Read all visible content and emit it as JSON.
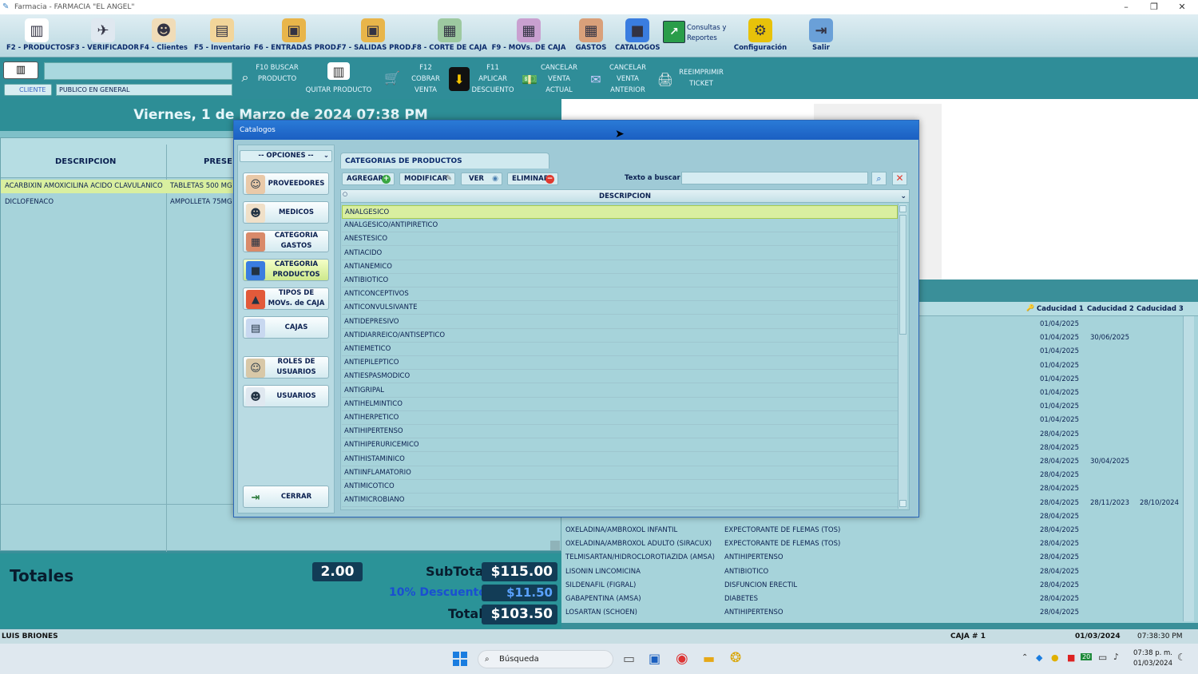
{
  "window": {
    "title": "Farmacia  -  FARMACIA \"EL ANGEL\""
  },
  "toolbar1": [
    {
      "label": "F2 - PRODUCTOS",
      "icon": "barcode-icon",
      "name": "productos"
    },
    {
      "label": "F3 - VERIFICADOR",
      "icon": "scanner-icon",
      "name": "verificador"
    },
    {
      "label": "F4 - Clientes",
      "icon": "clients-icon",
      "name": "clientes"
    },
    {
      "label": "F5 - Inventario",
      "icon": "inventory-icon",
      "name": "inventario"
    },
    {
      "label": "F6 - ENTRADAS PROD.",
      "icon": "box-in-icon",
      "name": "entradas"
    },
    {
      "label": "F7 - SALIDAS PROD.",
      "icon": "box-out-icon",
      "name": "salidas"
    },
    {
      "label": "F8 - CORTE DE CAJA",
      "icon": "register-icon",
      "name": "corte"
    },
    {
      "label": "F9 - MOVs. DE CAJA",
      "icon": "cash-moves-icon",
      "name": "movs"
    },
    {
      "label": "GASTOS",
      "icon": "expenses-icon",
      "name": "gastos"
    },
    {
      "label": "CATALOGOS",
      "icon": "cubes-icon",
      "name": "catalogos"
    },
    {
      "label": "Configuración",
      "icon": "gear-icon",
      "name": "configuracion"
    },
    {
      "label": "Salir",
      "icon": "exit-icon",
      "name": "salir"
    }
  ],
  "consultas_label": "Consultas y Reportes",
  "toolbar2": {
    "cliente_label": "CLIENTE",
    "cliente_value": "PUBLICO EN GENERAL",
    "buscar": "F10 BUSCAR PRODUCTO",
    "quitar": "QUITAR PRODUCTO",
    "cobrar": "F12 COBRAR VENTA",
    "descuento": "F11 APLICAR DESCUENTO",
    "cancelar_actual": "CANCELAR VENTA ACTUAL",
    "cancelar_anterior": "CANCELAR VENTA ANTERIOR",
    "reimprimir": "REEIMPRIMIR TICKET"
  },
  "date_text": "Viernes, 1 de Marzo de 2024  07:38 PM",
  "sale_grid": {
    "headers": [
      "DESCRIPCION",
      "PRESE"
    ],
    "rows": [
      {
        "desc": "ACARBIXIN AMOXICILINA  ACIDO CLAVULANICO",
        "pres": "TABLETAS 500 MG"
      },
      {
        "desc": "DICLOFENACO",
        "pres": "AMPOLLETA 75MG"
      }
    ]
  },
  "totals": {
    "label": "Totales",
    "qty": "2.00",
    "subtotal_label": "SubTotal",
    "subtotal": "$115.00",
    "discount_label": "10% Descuento",
    "discount": "$11.50",
    "total_label": "Total",
    "total": "$103.50"
  },
  "expiry_grid": {
    "headers": [
      "Caducidad 1",
      "Caducidad 2",
      "Caducidad 3"
    ],
    "top_rows": [
      [
        "01/04/2025",
        "",
        ""
      ],
      [
        "01/04/2025",
        "30/06/2025",
        ""
      ],
      [
        "01/04/2025",
        "",
        ""
      ],
      [
        "01/04/2025",
        "",
        ""
      ],
      [
        "01/04/2025",
        "",
        ""
      ],
      [
        "01/04/2025",
        "",
        ""
      ],
      [
        "01/04/2025",
        "",
        ""
      ],
      [
        "01/04/2025",
        "",
        ""
      ],
      [
        "28/04/2025",
        "",
        ""
      ],
      [
        "28/04/2025",
        "",
        ""
      ],
      [
        "28/04/2025",
        "30/04/2025",
        ""
      ],
      [
        "28/04/2025",
        "",
        ""
      ],
      [
        "28/04/2025",
        "",
        ""
      ],
      [
        "28/04/2025",
        "28/11/2023",
        "28/10/2024"
      ],
      [
        "28/04/2025",
        "",
        ""
      ]
    ],
    "bottom_rows": [
      {
        "prod": "OXELADINA/AMBROXOL INFANTIL",
        "cat": "EXPECTORANTE DE FLEMAS (TOS)",
        "c1": "28/04/2025"
      },
      {
        "prod": "OXELADINA/AMBROXOL ADULTO (SIRACUX)",
        "cat": "EXPECTORANTE DE FLEMAS (TOS)",
        "c1": "28/04/2025"
      },
      {
        "prod": "TELMISARTAN/HIDROCLOROTIAZIDA (AMSA)",
        "cat": "ANTIHIPERTENSO",
        "c1": "28/04/2025"
      },
      {
        "prod": "LISONIN LINCOMICINA",
        "cat": "ANTIBIOTICO",
        "c1": "28/04/2025"
      },
      {
        "prod": "SILDENAFIL (FIGRAL)",
        "cat": "DISFUNCION ERECTIL",
        "c1": "28/04/2025"
      },
      {
        "prod": "GABAPENTINA (AMSA)",
        "cat": "DIABETES",
        "c1": "28/04/2025"
      },
      {
        "prod": "LOSARTAN (SCHOEN)",
        "cat": "ANTIHIPERTENSO",
        "c1": "28/04/2025"
      }
    ]
  },
  "status": {
    "user": "LUIS BRIONES",
    "caja": "CAJA # 1",
    "date": "01/03/2024",
    "time": "07:38:30 PM"
  },
  "taskbar": {
    "search": "Búsqueda",
    "clock_time": "07:38 p. m.",
    "clock_date": "01/03/2024",
    "badge": "20"
  },
  "modal": {
    "title": "Catalogos",
    "opciones": "-- OPCIONES --",
    "side": [
      {
        "label": "PROVEEDORES",
        "icon": "suppliers-icon",
        "name": "proveedores"
      },
      {
        "label": "MEDICOS",
        "icon": "doctor-icon",
        "name": "medicos"
      },
      {
        "label": "CATEGORIA GASTOS",
        "icon": "expenses-icon",
        "name": "categoria-gastos"
      },
      {
        "label": "CATEGORIA PRODUCTOS",
        "icon": "cubes-icon",
        "name": "categoria-productos"
      },
      {
        "label": "TIPOS DE MOVs. de CAJA",
        "icon": "shapes-icon",
        "name": "tipos-movs"
      },
      {
        "label": "CAJAS",
        "icon": "register-icon",
        "name": "cajas"
      },
      {
        "label": "ROLES DE USUARIOS",
        "icon": "roles-icon",
        "name": "roles"
      },
      {
        "label": "USUARIOS",
        "icon": "user-icon",
        "name": "usuarios"
      }
    ],
    "cerrar": "CERRAR",
    "tab": "CATEGORIAS DE PRODUCTOS",
    "actions": {
      "agregar": "AGREGAR",
      "modificar": "MODIFICAR",
      "ver": "VER",
      "eliminar": "ELIMINAR"
    },
    "search_label": "Texto a buscar",
    "search_value": "",
    "col_header": "DESCRIPCION",
    "items": [
      "ANALGESICO",
      "ANALGESICO/ANTIPIRETICO",
      "ANESTESICO",
      "ANTIACIDO",
      "ANTIANEMICO",
      "ANTIBIOTICO",
      "ANTICONCEPTIVOS",
      "ANTICONVULSIVANTE",
      "ANTIDEPRESIVO",
      "ANTIDIARREICO/ANTISEPTICO",
      "ANTIEMETICO",
      "ANTIEPILEPTICO",
      "ANTIESPASMODICO",
      "ANTIGRIPAL",
      "ANTIHELMINTICO",
      "ANTIHERPETICO",
      "ANTIHIPERTENSO",
      "ANTIHIPERURICEMICO",
      "ANTIHISTAMINICO",
      "ANTIINFLAMATORIO",
      "ANTIMICOTICO",
      "ANTIMICROBIANO"
    ]
  },
  "colors": {
    "teal": "#2f8d98",
    "grid": "#a6d3da",
    "modal_title": "#1b5fc2",
    "selected": "#d9efa0"
  }
}
